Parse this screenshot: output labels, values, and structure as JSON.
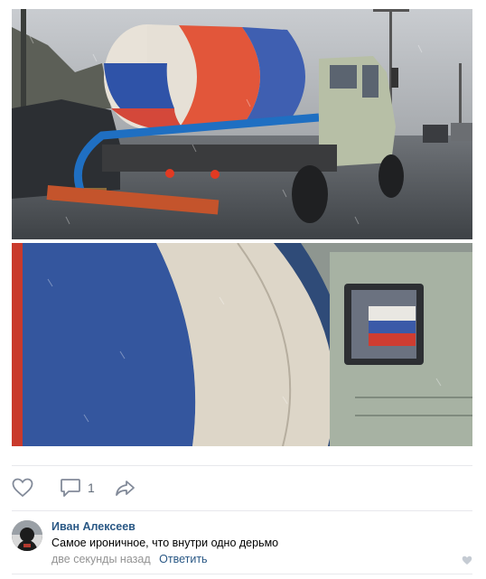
{
  "post": {
    "photos": [
      {
        "description_icon": "truck-photo"
      },
      {
        "description_icon": "tank-closeup-photo"
      }
    ],
    "actions": {
      "like_count": "",
      "comment_count": "1",
      "share_count": ""
    }
  },
  "comment": {
    "author": "Иван Алексеев",
    "text": "Самое ироничное, что внутри одно дерьмо",
    "time": "две секунды назад",
    "reply_label": "Ответить"
  },
  "colors": {
    "link": "#2a5885",
    "meta": "#939393",
    "icon": "#828a99",
    "divider": "#e7e8ec"
  }
}
